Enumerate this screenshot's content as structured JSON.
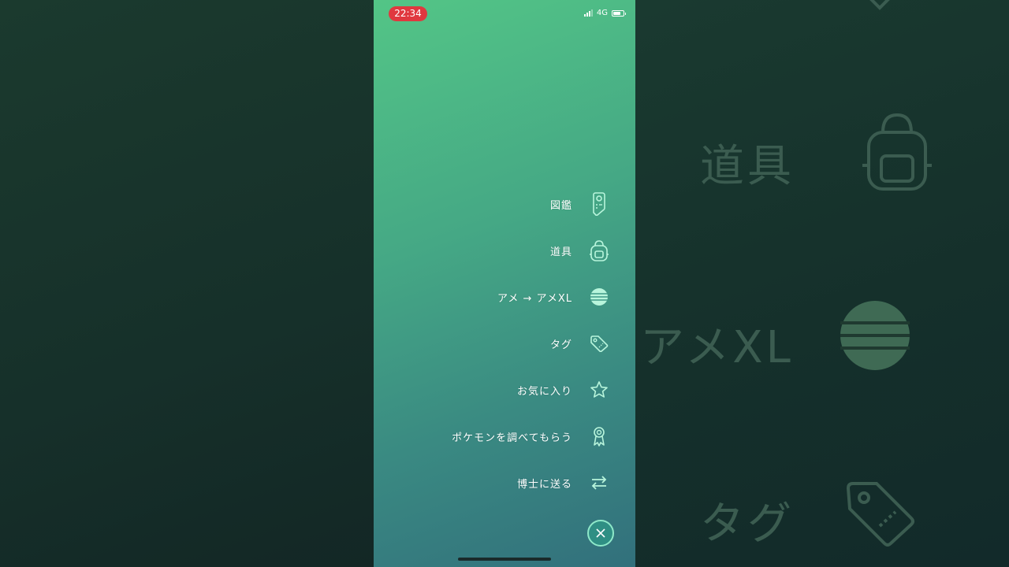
{
  "status_bar": {
    "time": "22:34",
    "network": "4G"
  },
  "menu": {
    "items": [
      {
        "label": "図鑑",
        "icon": "pokedex-icon"
      },
      {
        "label": "道具",
        "icon": "backpack-icon"
      },
      {
        "label": "アメ → アメXL",
        "icon": "candy-icon"
      },
      {
        "label": "タグ",
        "icon": "tag-icon"
      },
      {
        "label": "お気に入り",
        "icon": "star-icon"
      },
      {
        "label": "ポケモンを調べてもらう",
        "icon": "ribbon-icon"
      },
      {
        "label": "博士に送る",
        "icon": "transfer-icon"
      }
    ],
    "close_icon": "close-icon"
  },
  "background": {
    "zoom_labels": [
      "道具",
      "アメXL",
      "タグ"
    ]
  },
  "colors": {
    "accent": "#8ee8c9",
    "time_pill": "#e0383f",
    "close_button": "#2f8f84"
  }
}
